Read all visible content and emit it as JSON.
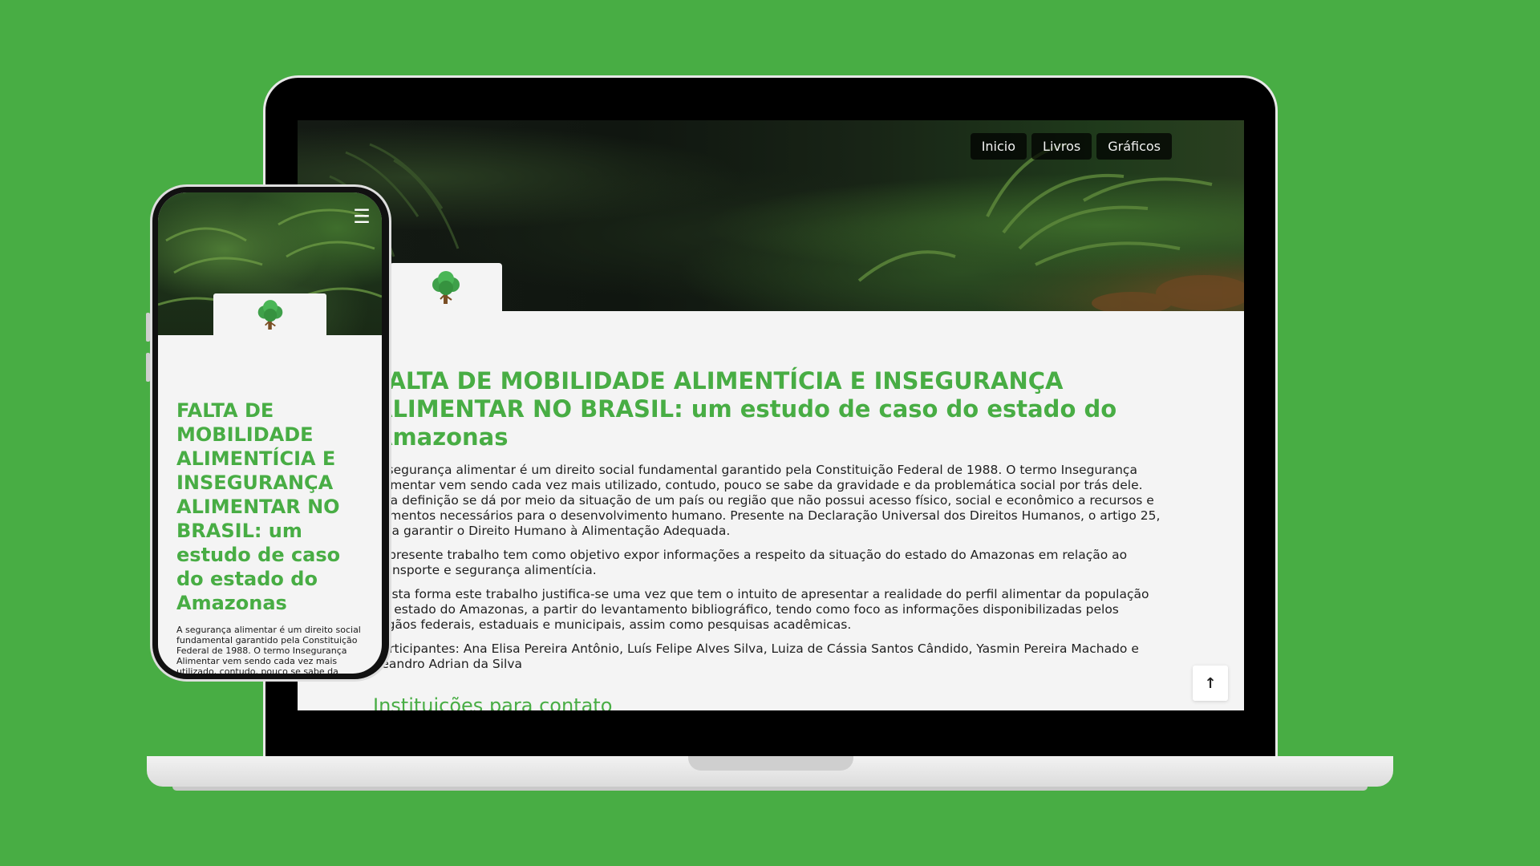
{
  "nav": {
    "items": [
      "Inicio",
      "Livros",
      "Gráficos"
    ]
  },
  "page": {
    "title": "FALTA DE MOBILIDADE ALIMENTÍCIA E INSEGURANÇA ALIMENTAR NO BRASIL: um estudo de caso do estado do Amazonas",
    "paragraphs": [
      "A segurança alimentar é um direito social fundamental garantido pela Constituição Federal de 1988. O termo Insegurança Alimentar vem sendo cada vez mais utilizado, contudo, pouco se sabe da gravidade e da problemática social por trás dele. Sua definição se dá por meio da situação de um país ou região que não possui acesso físico, social e econômico a recursos e alimentos necessários para o desenvolvimento humano. Presente na Declaração Universal dos Direitos Humanos, o artigo 25, visa garantir o Direito Humano à Alimentação Adequada.",
      "O presente trabalho tem como objetivo expor informações a respeito da situação do estado do Amazonas em relação ao transporte e segurança alimentícia.",
      "Desta forma este trabalho justifica-se uma vez que tem o intuito de apresentar a realidade do perfil alimentar da população do estado do Amazonas, a partir do levantamento bibliográfico, tendo como foco as informações disponibilizadas pelos órgãos federais, estaduais e municipais, assim como pesquisas acadêmicas.",
      "Participantes: Ana Elisa Pereira Antônio, Luís Felipe Alves Silva, Luiza de Cássia Santos Cândido, Yasmin Pereira Machado e Leandro Adrian da Silva"
    ],
    "section_title": "Instituições para contato",
    "back_to_top": "↑"
  },
  "phone": {
    "menu_icon": "☰",
    "title": "FALTA DE MOBILIDADE ALIMENTÍCIA E INSEGURANÇA ALIMENTAR NO BRASIL: um estudo de caso do estado do Amazonas",
    "paragraph": "A segurança alimentar é um direito social fundamental garantido pela Constituição Federal de 1988. O termo Insegurança Alimentar vem sendo cada vez mais utilizado, contudo, pouco se sabe da"
  },
  "colors": {
    "background": "#48ad44",
    "accent": "#48ad44",
    "page_bg": "#f4f4f4"
  },
  "icons": {
    "logo": "tree-icon",
    "menu": "hamburger-icon",
    "back_to_top": "arrow-up-icon"
  }
}
